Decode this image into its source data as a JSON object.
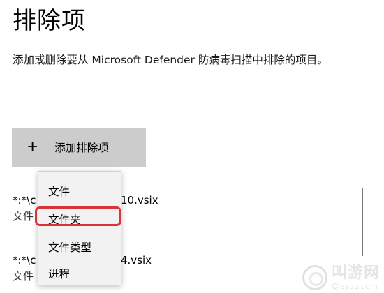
{
  "page": {
    "title": "排除项",
    "description": "添加或删除要从 Microsoft Defender 防病毒扫描中排除的项目。"
  },
  "add_button": {
    "icon": "plus-icon",
    "icon_glyph": "+",
    "label": "添加排除项"
  },
  "exclusions": [
    {
      "path_prefix": "*:*\\c",
      "path_suffix": "10.vsix",
      "type": "文件"
    },
    {
      "path_prefix": "*:*\\c",
      "path_suffix": "4.vsix",
      "type": "文件"
    }
  ],
  "dropdown": {
    "items": [
      {
        "label": "文件"
      },
      {
        "label": "文件夹",
        "highlighted": true
      },
      {
        "label": "文件类型"
      },
      {
        "label": "进程"
      }
    ],
    "highlight_color": "#d9343c"
  },
  "watermark": {
    "text_cn": "叫游网",
    "text_en": "Qieyou.com"
  }
}
